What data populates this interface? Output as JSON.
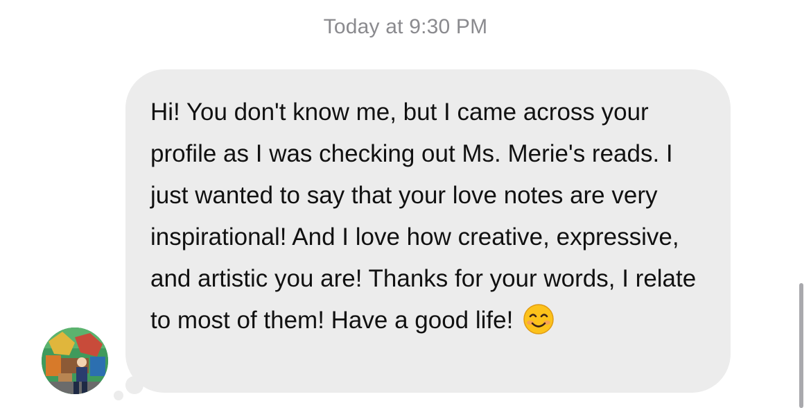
{
  "conversation": {
    "timestamp": "Today at 9:30 PM"
  },
  "message": {
    "text": "Hi! You don't know me, but I came across your profile as I was checking out Ms. Merie's reads. I just wanted to say that your love notes are very inspirational! And I love how creative, expressive, and artistic you are! Thanks for your words, I relate to most of them! Have a good life!",
    "emoji": "smiling-face-with-smiling-eyes",
    "sender_avatar": "avatar"
  },
  "colors": {
    "bubble": "#ececec",
    "timestamp": "#8a8a8e",
    "text": "#111111"
  }
}
